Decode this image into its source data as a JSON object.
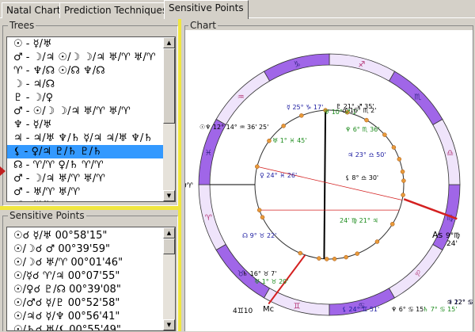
{
  "tabs": [
    {
      "label": "Natal Chart"
    },
    {
      "label": "Prediction Techniques"
    },
    {
      "label": "Sensitive Points",
      "active": true
    }
  ],
  "trees": {
    "title": "Trees",
    "selected_index": 8,
    "items": [
      "☉ - ☿/♅",
      "♂ - ☽/♃ ☉/☽ ☽/♃ ♅/♈ ♅/♈",
      "♈ - ♆/☊ ☉/☊ ♆/☊",
      "☽ - ♃/☊",
      "♇ - ☽/♀",
      "♂ - ☉/☽ ☽/♃ ♅/♈ ♅/♈",
      "♆ - ☿/♅",
      "♃ - ♃/♅ ♆/♄ ☿/♃ ♃/♅ ♆/♄",
      "⚸ - ♀/♃ ♇/♄ ♇/♄",
      "☊ - ♈/♈ ♀/♄ ♈/♈",
      "♂ - ☽/♃ ♅/♈ ♅/♈",
      "♂ - ♅/♈ ♅/♈",
      "♂ - ♅/♈"
    ]
  },
  "sensitive_points": {
    "title": "Sensitive Points",
    "items": [
      "☉☌ ☿/♅ 00°58'15\"",
      "☉/☽☌ ♂ 00°39'59\"",
      "☉/☽☌ ♅/♈ 00°01'46\"",
      "☉/☿☌ ♈/♃ 00°07'55\"",
      "☉/♀☌ ♇/☊ 00°39'08\"",
      "☉/♂☌ ☿/♇ 00°52'58\"",
      "☉/♃☌ ☿/♆ 00°56'41\"",
      "☉/♄☌ ♅/⚸ 00°55'49\""
    ]
  },
  "chart": {
    "title": "Chart",
    "signs": [
      "♈",
      "♉",
      "♊",
      "♋",
      "♌",
      "♍",
      "♎",
      "♏",
      "♐",
      "♑",
      "♒",
      "♓"
    ],
    "colors": {
      "dark": "#a066e8",
      "light": "#efe4fb",
      "red": "#d42020",
      "dot": "#e89a3a",
      "green": "#1a8a1a",
      "blue": "#1a1aa0"
    },
    "labels": {
      "aries_point": "0♈",
      "asc": "As",
      "asc_deg": "9°♍",
      "asc_min": "24'",
      "mc": "Mc",
      "mc_deg": "4♊10"
    },
    "planets": [
      {
        "t": "♇ 21° ♐ 35'"
      },
      {
        "t": "♅ 10° ♐ 1'"
      },
      {
        "t": "☿ 25° ♑ 17'"
      },
      {
        "t": "☉♆ 12° 14° ♒ 36' 25'"
      },
      {
        "t": "♅ 1° ♓ 45'"
      },
      {
        "t": "♀ 24° ♓ 26'"
      },
      {
        "t": "♂ 16° ♏ 2'"
      },
      {
        "t": "♆ 6° ♏ 36'"
      },
      {
        "t": "♃ 23° ♎ 50'"
      },
      {
        "t": "⚸ 8° ♎ 30'"
      },
      {
        "t": "24' ♍ 21° ♃"
      },
      {
        "t": "☊ 9° ♉ 22'"
      },
      {
        "t": "♄ 16° ♉ 7'"
      },
      {
        "t": "♅ 1° ♉ 20'"
      },
      {
        "t": "⚸ 24° ♊ 51'"
      },
      {
        "t": "♆ 6° ♋ 15'"
      },
      {
        "t": "♄ 7° ♋ 15'"
      },
      {
        "t": "☽ 12° ♋ 34'"
      },
      {
        "t": "♃ 22° ♋ 16'"
      }
    ]
  }
}
